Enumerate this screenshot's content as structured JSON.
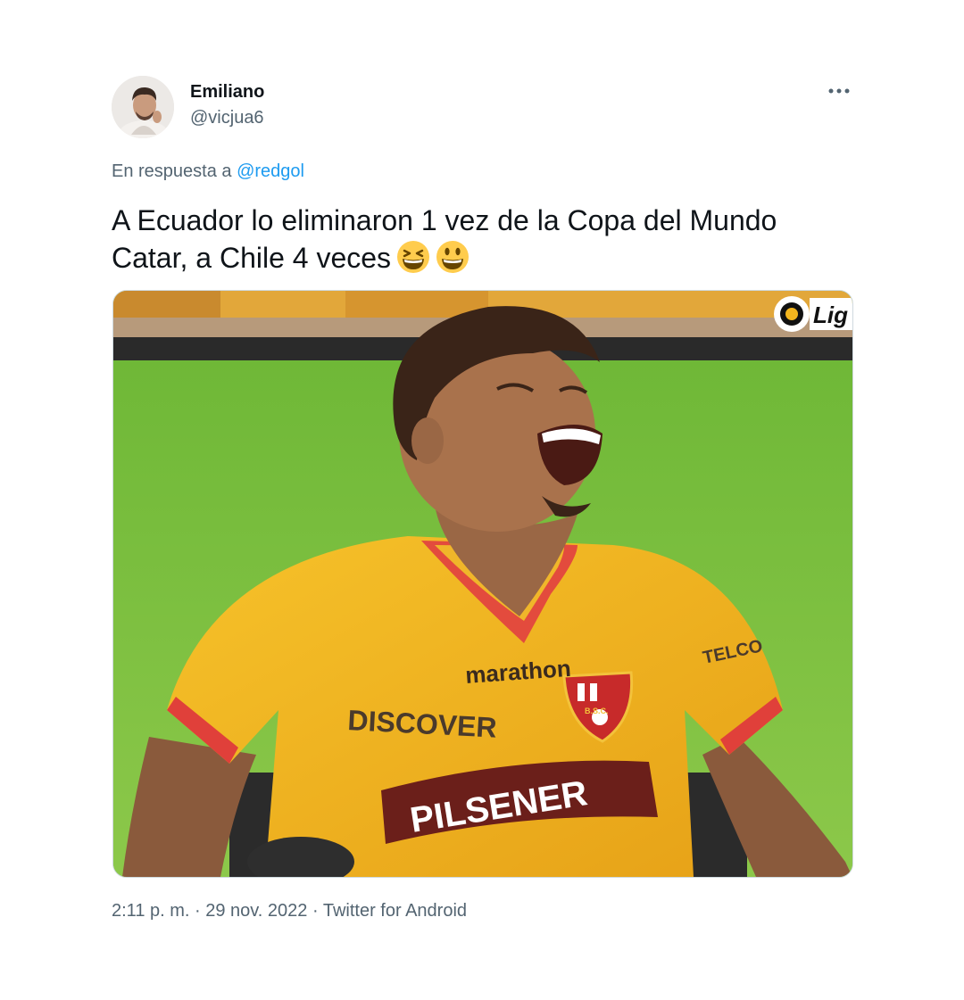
{
  "author": {
    "name": "Emiliano",
    "handle": "@vicjua6",
    "avatar_icon": "user-avatar"
  },
  "more_icon": "more-dots-icon",
  "reply": {
    "prefix": "En respuesta a",
    "mention": "@redgol"
  },
  "tweet": {
    "line1": "A Ecuador lo eliminaron 1 vez de la Copa del Mundo",
    "line2": "Catar, a Chile 4 veces",
    "emojis": [
      "grinning-squinting-face",
      "grinning-face-big-eyes"
    ]
  },
  "media": {
    "watermark": "Lig",
    "jersey_sponsor_1": "DISCOVER",
    "jersey_brand": "marathon",
    "jersey_sponsor_2": "TELCO",
    "jersey_sponsor_3": "PILSENER",
    "crest_text": "B.S.C."
  },
  "meta": {
    "time": "2:11 p. m.",
    "separator": " · ",
    "date": "29 nov. 2022",
    "source": "Twitter for Android"
  },
  "colors": {
    "text": "#0f1419",
    "secondary": "#536471",
    "link": "#1d9bf0",
    "jersey_yellow": "#f2b51e",
    "pitch_green": "#7fbf3c"
  }
}
